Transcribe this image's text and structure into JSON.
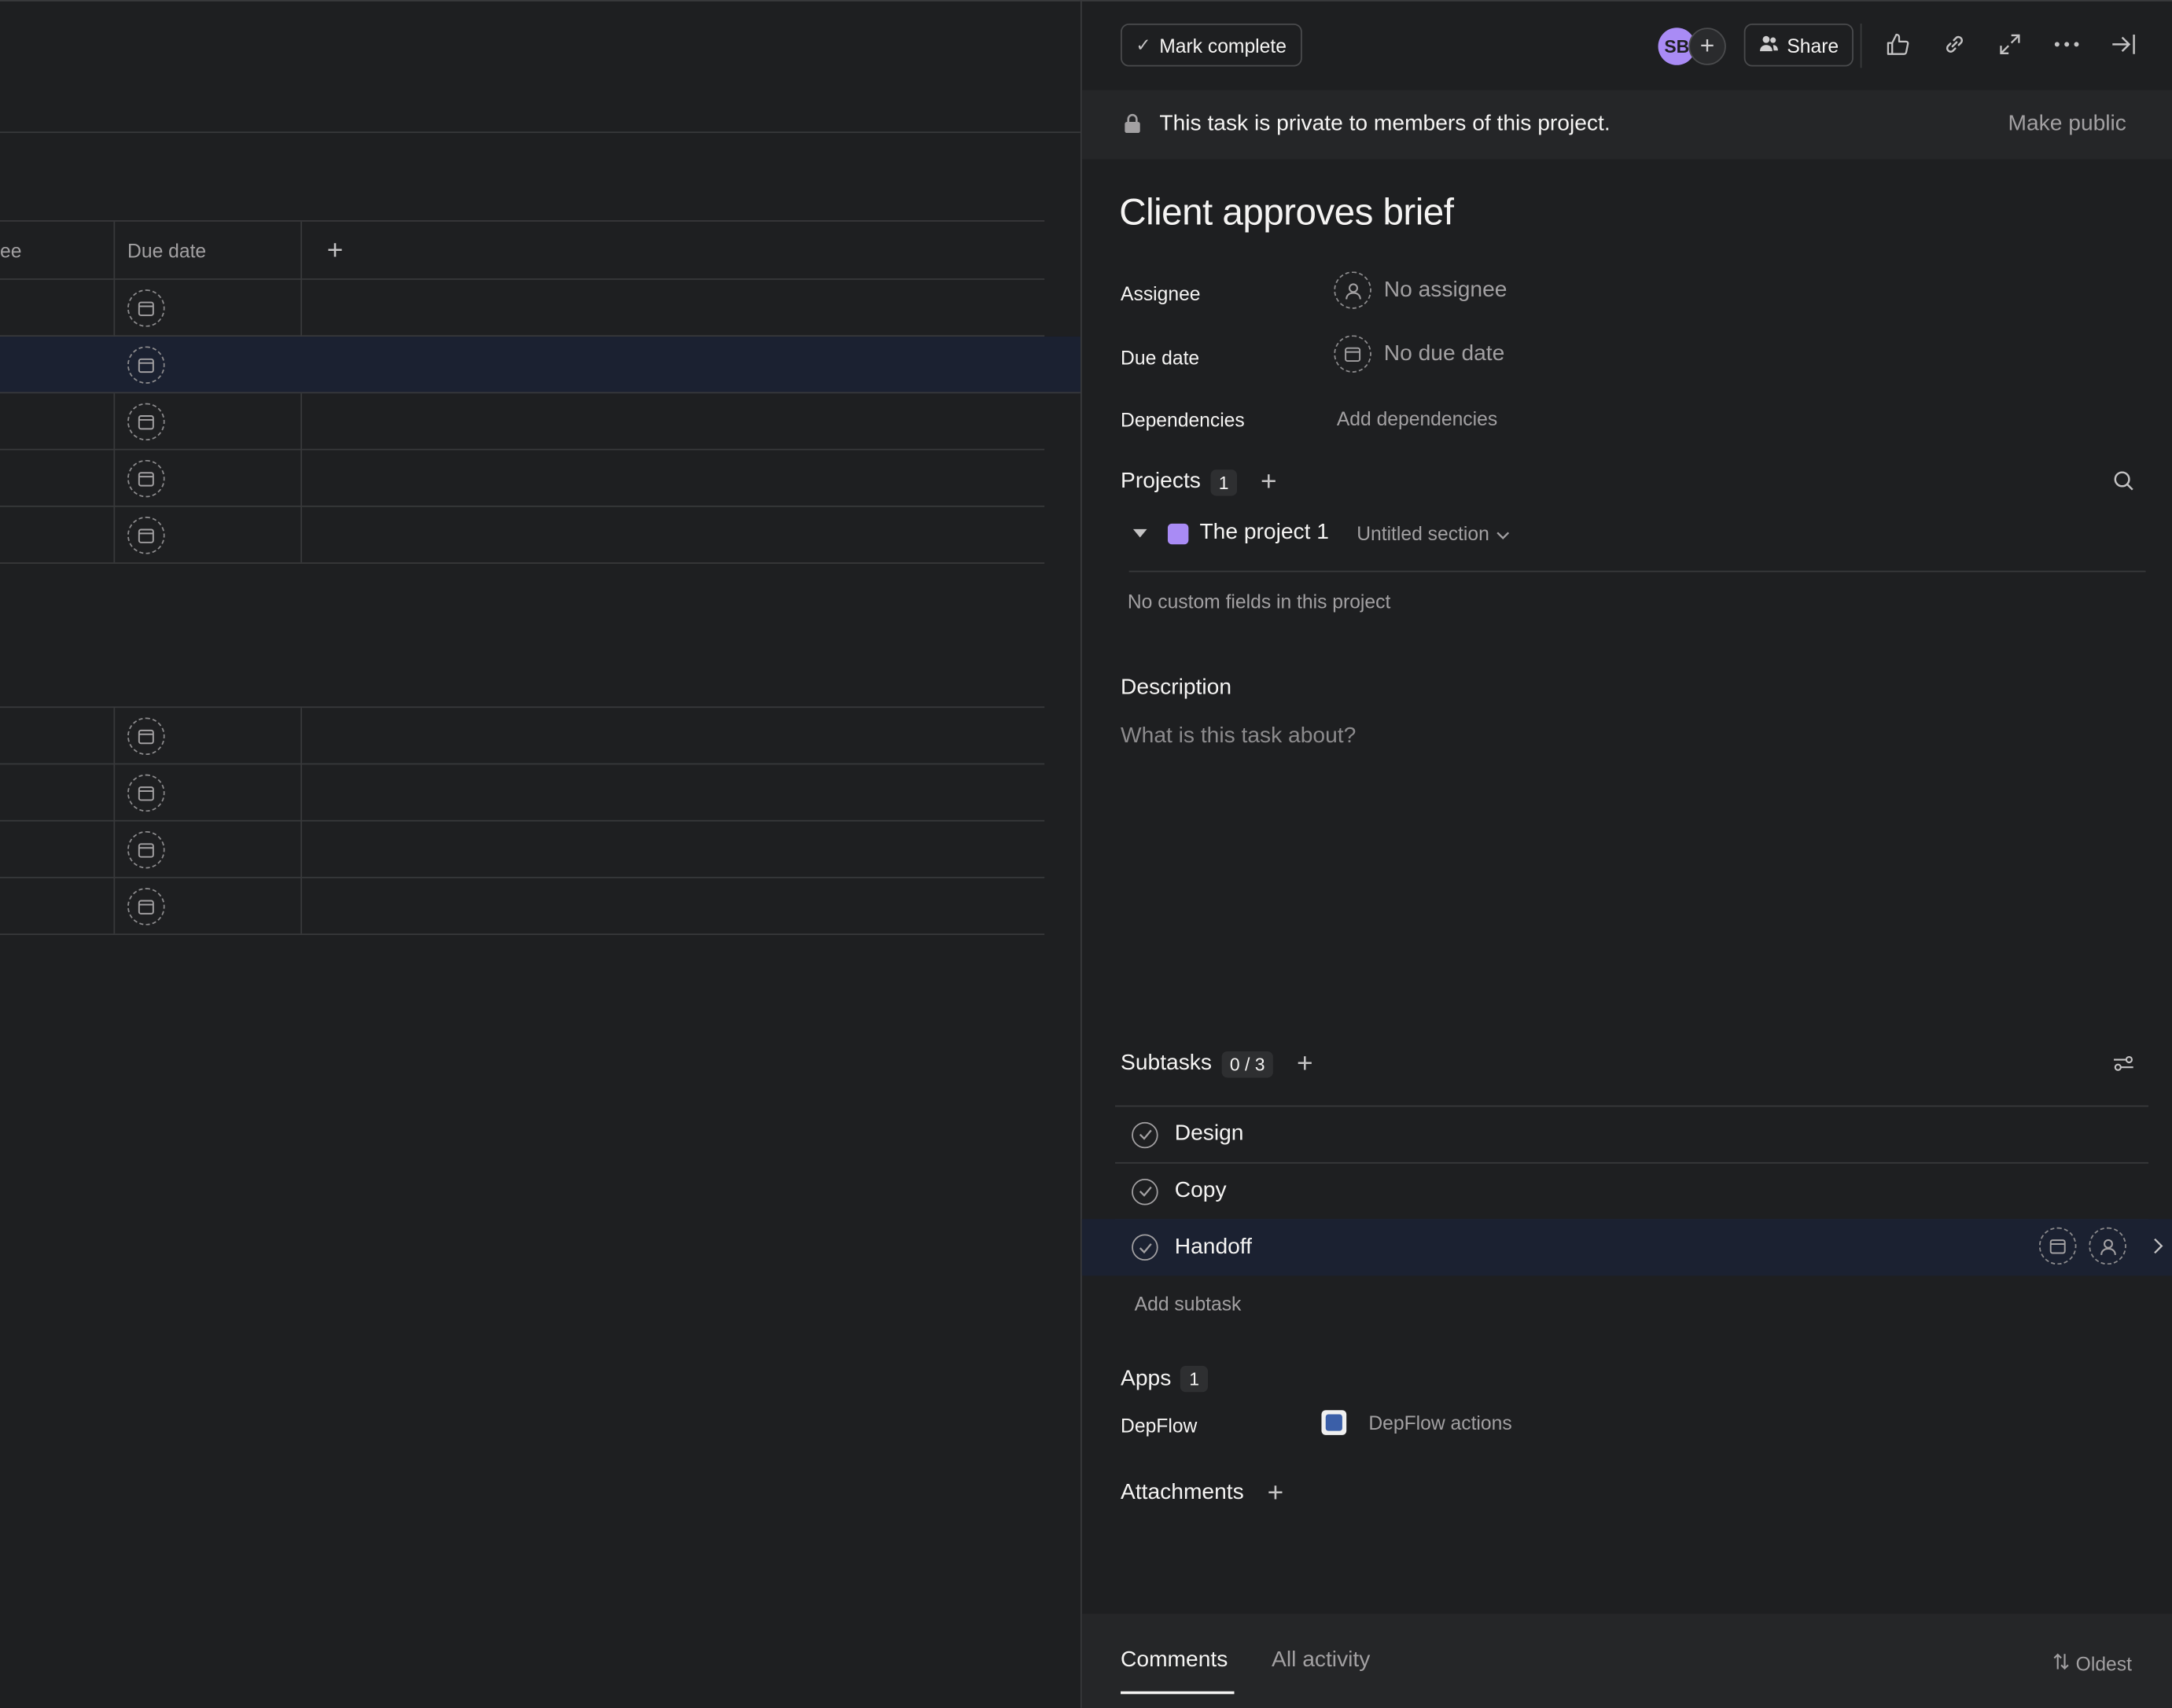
{
  "list": {
    "col_partial": "ee",
    "col_due_date": "Due date",
    "add_column": "+"
  },
  "topbar": {
    "mark_complete": "Mark complete",
    "avatar_initials": "SB",
    "share": "Share"
  },
  "privacy": {
    "text": "This task is private to members of this project.",
    "action": "Make public"
  },
  "task": {
    "title": "Client approves brief",
    "fields": {
      "assignee_label": "Assignee",
      "assignee_value": "No assignee",
      "due_label": "Due date",
      "due_value": "No due date",
      "deps_label": "Dependencies",
      "deps_value": "Add dependencies"
    }
  },
  "projects": {
    "title": "Projects",
    "count": "1",
    "project_name": "The project 1",
    "section": "Untitled section",
    "no_fields": "No custom fields in this project",
    "swatch_color": "#a98bf5"
  },
  "description": {
    "title": "Description",
    "placeholder": "What is this task about?"
  },
  "subtasks": {
    "title": "Subtasks",
    "count": "0 / 3",
    "items": [
      {
        "label": "Design"
      },
      {
        "label": "Copy"
      },
      {
        "label": "Handoff"
      }
    ],
    "add": "Add subtask"
  },
  "apps": {
    "title": "Apps",
    "count": "1",
    "app_label": "DepFlow",
    "app_action": "DepFlow actions"
  },
  "attachments": {
    "title": "Attachments"
  },
  "comments": {
    "tab_comments": "Comments",
    "tab_activity": "All activity",
    "sort": "Oldest"
  }
}
